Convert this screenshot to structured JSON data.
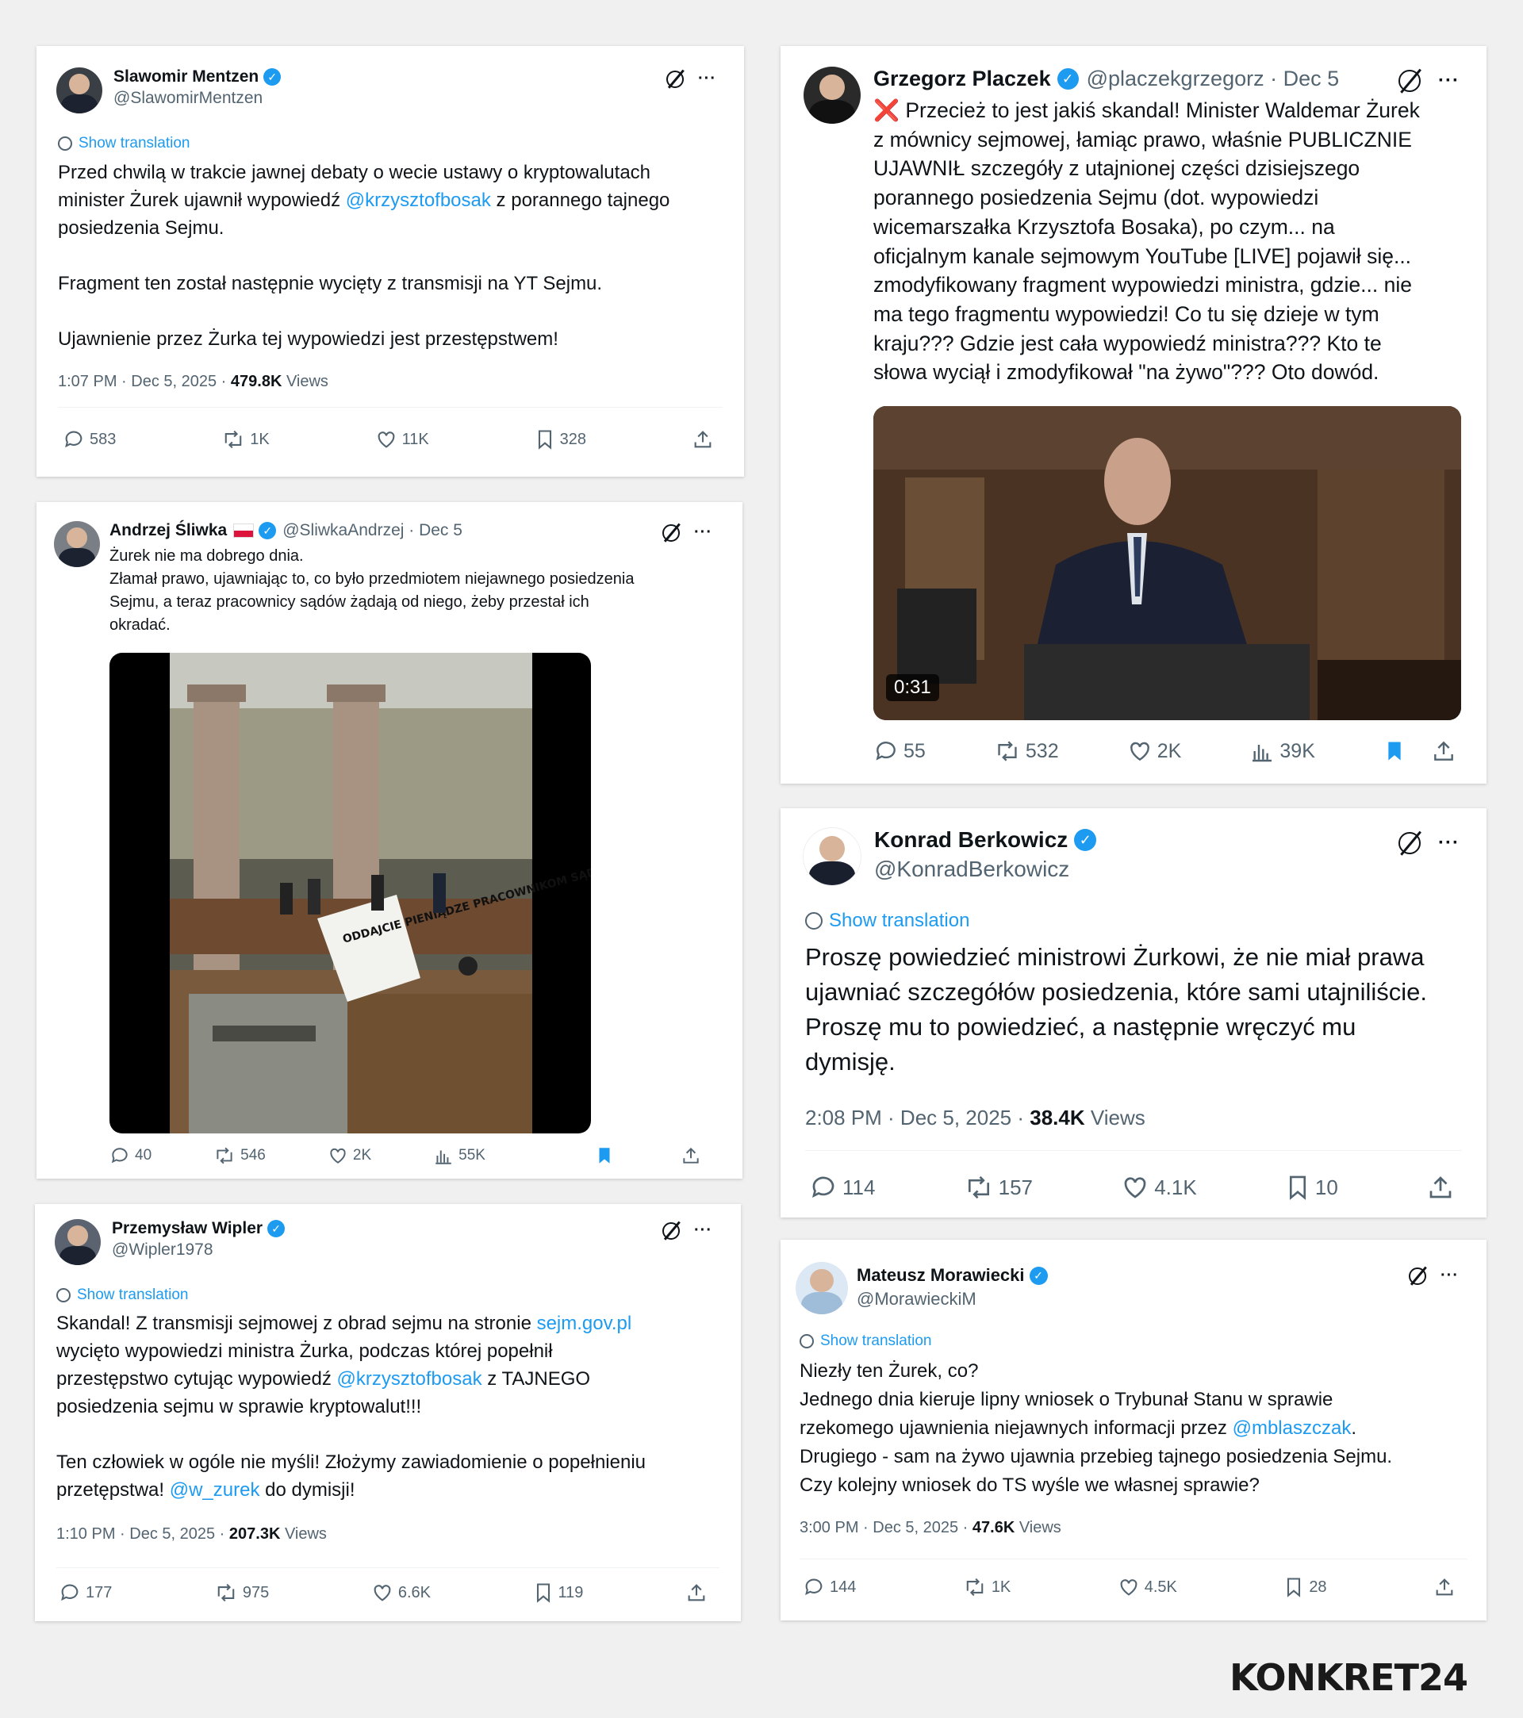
{
  "tweets": {
    "mentzen": {
      "name": "Slawomir Mentzen",
      "handle": "@SlawomirMentzen",
      "translate": "Show translation",
      "text_a": "Przed chwilą w trakcie jawnej debaty o wecie ustawy o kryptowalutach\nminister Żurek ujawnił wypowiedź ",
      "mention": "@krzysztofbosak",
      "text_b": " z porannego tajnego\nposiedzenia Sejmu.\n\nFragment ten został następnie wycięty z transmisji na YT Sejmu.\n\nUjawnienie przez Żurka tej wypowiedzi jest przestępstwem!",
      "time": "1:07 PM · Dec 5, 2025 · ",
      "views": "479.8K",
      "views_label": " Views",
      "replies": "583",
      "reposts": "1K",
      "likes": "11K",
      "bookmarks": "328"
    },
    "sliwka": {
      "name": "Andrzej Śliwka",
      "handle": "@SliwkaAndrzej · Dec 5",
      "text": "Żurek nie ma dobrego dnia.\nZłamał prawo, ujawniając to, co było przedmiotem niejawnego posiedzenia\nSejmu, a teraz pracownicy sądów żądają od niego, żeby przestał ich\nokradać.",
      "replies": "40",
      "reposts": "546",
      "likes": "2K",
      "views": "55K"
    },
    "wipler": {
      "name": "Przemysław Wipler",
      "handle": "@Wipler1978",
      "translate": "Show translation",
      "text_a": "Skandal! Z transmisji sejmowej z obrad sejmu na stronie ",
      "link1": "sejm.gov.pl",
      "text_b": "\nwycięto wypowiedzi ministra Żurka, podczas której popełnił\nprzestępstwo cytując wypowiedź ",
      "mention1": "@krzysztofbosak",
      "text_c": " z TAJNEGO\nposiedzenia sejmu w sprawie kryptowalut!!!\n\nTen człowiek w ogóle nie myśli! Złożymy zawiadomienie o popełnieniu\nprzetępstwa! ",
      "mention2": "@w_zurek",
      "text_d": " do dymisji!",
      "time": "1:10 PM · Dec 5, 2025 · ",
      "views": "207.3K",
      "views_label": " Views",
      "replies": "177",
      "reposts": "975",
      "likes": "6.6K",
      "bookmarks": "119"
    },
    "placzek": {
      "name": "Grzegorz Placzek",
      "handle": "@placzekgrzegorz · Dec 5",
      "text": "❌ Przecież to jest jakiś skandal! Minister Waldemar Żurek\nz mównicy sejmowej, łamiąc prawo, właśnie PUBLICZNIE\nUJAWNIŁ szczegóły z utajnionej części dzisiejszego\nporannego posiedzenia Sejmu (dot. wypowiedzi\nwicemarszałka Krzysztofa Bosaka), po czym... na\noficjalnym kanale sejmowym YouTube [LIVE] pojawił się...\nzmodyfikowany fragment wypowiedzi ministra, gdzie... nie\nma tego fragmentu wypowiedzi! Co tu się dzieje w tym\nkraju??? Gdzie jest cała wypowiedź ministra??? Kto te\nsłowa wyciął i zmodyfikował \"na żywo\"??? Oto dowód.",
      "duration": "0:31",
      "replies": "55",
      "reposts": "532",
      "likes": "2K",
      "views": "39K"
    },
    "berkowicz": {
      "name": "Konrad Berkowicz",
      "handle": "@KonradBerkowicz",
      "translate": "Show translation",
      "text": "Proszę powiedzieć ministrowi Żurkowi, że nie miał prawa\nujawniać szczegółów posiedzenia, które sami utajniliście.\nProszę mu to powiedzieć, a następnie wręczyć mu\ndymisję.",
      "time": "2:08 PM · Dec 5, 2025 · ",
      "views": "38.4K",
      "views_label": " Views",
      "replies": "114",
      "reposts": "157",
      "likes": "4.1K",
      "bookmarks": "10"
    },
    "morawiecki": {
      "name": "Mateusz Morawiecki",
      "handle": "@MorawieckiM",
      "translate": "Show translation",
      "text_a": "Niezły ten Żurek, co?\nJednego dnia kieruje lipny wniosek o Trybunał Stanu w sprawie\nrzekomego ujawnienia niejawnych informacji przez ",
      "mention": "@mblaszczak",
      "text_b": ".\nDrugiego - sam na żywo ujawnia przebieg tajnego posiedzenia Sejmu.\nCzy kolejny wniosek do TS wyśle we własnej sprawie?",
      "time": "3:00 PM · Dec 5, 2025 · ",
      "views": "47.6K",
      "views_label": " Views",
      "replies": "144",
      "reposts": "1K",
      "likes": "4.5K",
      "bookmarks": "28"
    }
  },
  "banner_text": "ODDAJCIE PIENIĄDZE PRACOWNIKOM SĄDÓW",
  "logo": "KONKRET24",
  "colors": {
    "link": "#1d9bf0",
    "muted": "#536471",
    "verified": "#1d9bf0",
    "bookmark_active": "#1d9bf0"
  }
}
